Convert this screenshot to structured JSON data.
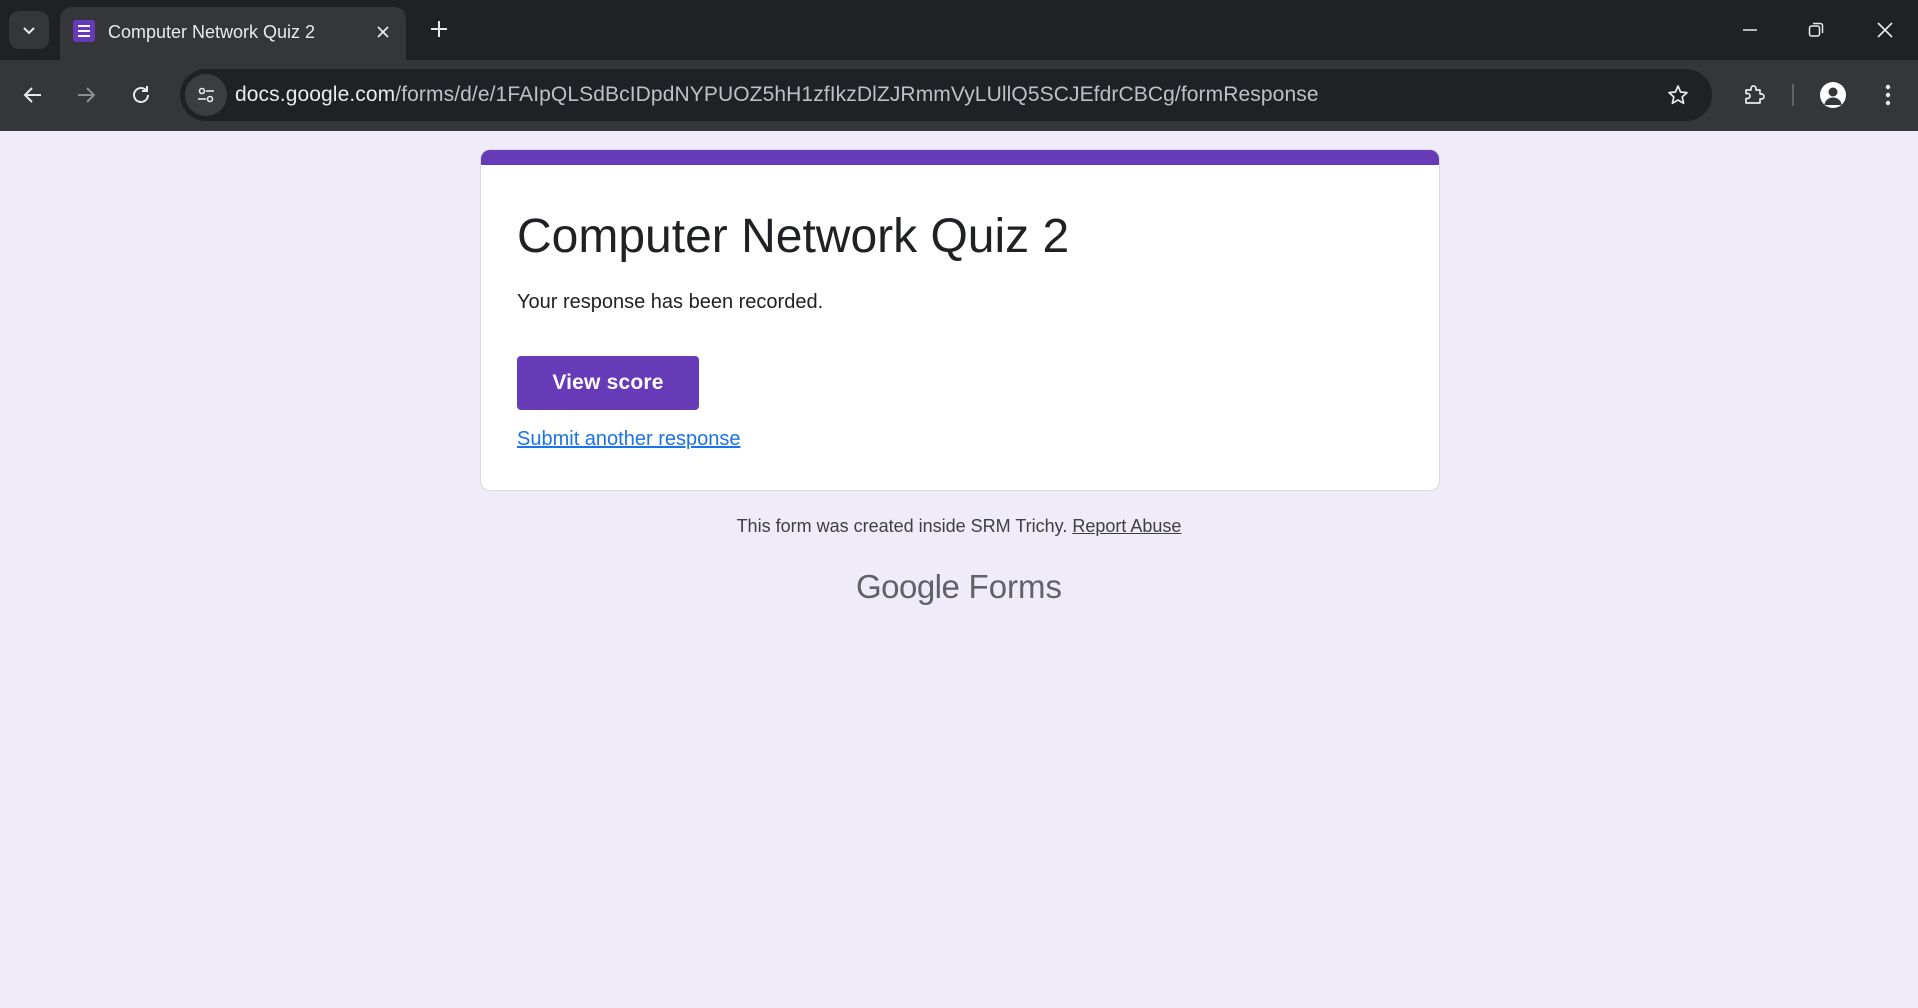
{
  "browser": {
    "tab": {
      "title": "Computer Network Quiz 2",
      "favicon": "google-forms-icon"
    },
    "address_bar": {
      "domain": "docs.google.com",
      "path": "/forms/d/e/1FAIpQLSdBcIDpdNYPUOZ5hH1zfIkzDlZJRmmVyLUllQ5SCJEfdrCBCg/formResponse"
    },
    "icons": {
      "tab_search": "chevron-down-icon",
      "close_tab": "close-icon",
      "new_tab": "plus-icon",
      "back": "arrow-left-icon",
      "forward": "arrow-right-icon",
      "reload": "reload-icon",
      "site_info": "tune-icon",
      "bookmark": "star-icon",
      "extensions": "puzzle-icon",
      "profile": "person-icon",
      "menu": "kebab-icon",
      "minimize": "minimize-icon",
      "restore": "restore-icon",
      "close_window": "close-icon"
    }
  },
  "form": {
    "title": "Computer Network Quiz 2",
    "confirmation": "Your response has been recorded.",
    "view_score_label": "View score",
    "submit_another_label": "Submit another response",
    "accent_color": "#673ab7"
  },
  "footer": {
    "text": "This form was created inside SRM Trichy.",
    "report_abuse": "Report Abuse",
    "logo_google": "Google",
    "logo_forms": "Forms"
  },
  "colors": {
    "page_background": "#f0ebf8",
    "link": "#1a73e8"
  }
}
